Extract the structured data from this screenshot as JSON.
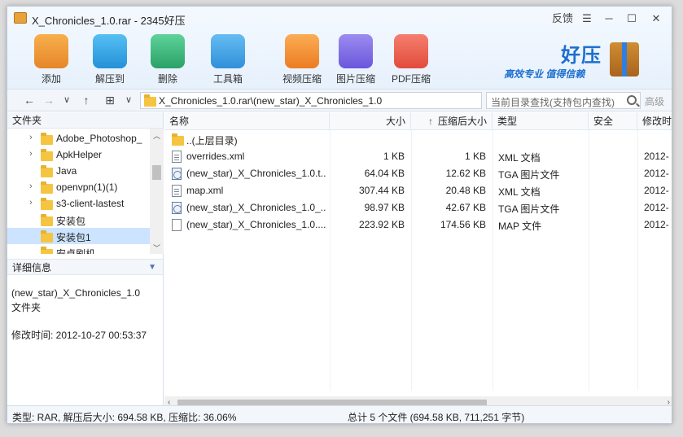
{
  "window": {
    "title": "X_Chronicles_1.0.rar - 2345好压"
  },
  "titlebar_controls": {
    "feedback": "反馈",
    "menu": "☰",
    "minimize": "─",
    "maximize": "☐",
    "close": "✕"
  },
  "toolbar": [
    {
      "label": "添加",
      "icon": "add-box-icon",
      "color": "#f29a38"
    },
    {
      "label": "解压到",
      "icon": "extract-box-icon",
      "color": "#2fa5e8"
    },
    {
      "label": "删除",
      "icon": "recycle-bin-icon",
      "color": "#39b37a"
    },
    {
      "label": "工具箱",
      "icon": "toolbox-icon",
      "color": "#3ba0e6"
    },
    {
      "label": "视频压缩",
      "icon": "video-compress-icon",
      "color": "#f28a2e"
    },
    {
      "label": "图片压缩",
      "icon": "image-compress-icon",
      "color": "#7b6be6"
    },
    {
      "label": "PDF压缩",
      "icon": "pdf-compress-icon",
      "color": "#ee5a4a"
    }
  ],
  "logo": {
    "title": "好压",
    "tagline": "高效专业 值得信赖"
  },
  "nav": {
    "back": "←",
    "forward": "→",
    "dropdown": "∨",
    "up": "↑",
    "view": "⊞",
    "view_dropdown": "∨"
  },
  "address": {
    "path": "X_Chronicles_1.0.rar\\(new_star)_X_Chronicles_1.0"
  },
  "search": {
    "placeholder": "当前目录查找(支持包内查找)",
    "advanced": "高级"
  },
  "folder_pane": {
    "header": "文件夹",
    "items": [
      {
        "label": "Adobe_Photoshop_",
        "expandable": true
      },
      {
        "label": "ApkHelper",
        "expandable": true
      },
      {
        "label": "Java",
        "expandable": false
      },
      {
        "label": "openvpn(1)(1)",
        "expandable": true
      },
      {
        "label": "s3-client-lastest",
        "expandable": true
      },
      {
        "label": "安装包",
        "expandable": false
      },
      {
        "label": "安装包1",
        "expandable": false,
        "selected": true
      },
      {
        "label": "安卓刷机",
        "expandable": false
      }
    ]
  },
  "details": {
    "header": "详细信息",
    "name": "(new_star)_X_Chronicles_1.0",
    "type": "文件夹",
    "modified": "修改时间: 2012-10-27 00:53:37"
  },
  "columns": {
    "name": "名称",
    "size": "大小",
    "compressed": "压缩后大小",
    "type": "类型",
    "security": "安全",
    "modified": "修改时"
  },
  "files": [
    {
      "name": "..(上层目录)",
      "size": "",
      "compressed": "",
      "type": "",
      "modified": "",
      "kind": "folder"
    },
    {
      "name": "overrides.xml",
      "size": "1 KB",
      "compressed": "1 KB",
      "type": "XML 文档",
      "modified": "2012-",
      "kind": "xml"
    },
    {
      "name": "(new_star)_X_Chronicles_1.0.t...",
      "size": "64.04 KB",
      "compressed": "12.62 KB",
      "type": "TGA 图片文件",
      "modified": "2012-",
      "kind": "tga"
    },
    {
      "name": "map.xml",
      "size": "307.44 KB",
      "compressed": "20.48 KB",
      "type": "XML 文档",
      "modified": "2012-",
      "kind": "xml"
    },
    {
      "name": "(new_star)_X_Chronicles_1.0_...",
      "size": "98.97 KB",
      "compressed": "42.67 KB",
      "type": "TGA 图片文件",
      "modified": "2012-",
      "kind": "tga"
    },
    {
      "name": "(new_star)_X_Chronicles_1.0....",
      "size": "223.92 KB",
      "compressed": "174.56 KB",
      "type": "MAP 文件",
      "modified": "2012-",
      "kind": "file"
    }
  ],
  "status": {
    "left": "类型: RAR, 解压后大小: 694.58 KB, 压缩比: 36.06%",
    "right": "总计 5 个文件 (694.58 KB, 711,251 字节)"
  }
}
